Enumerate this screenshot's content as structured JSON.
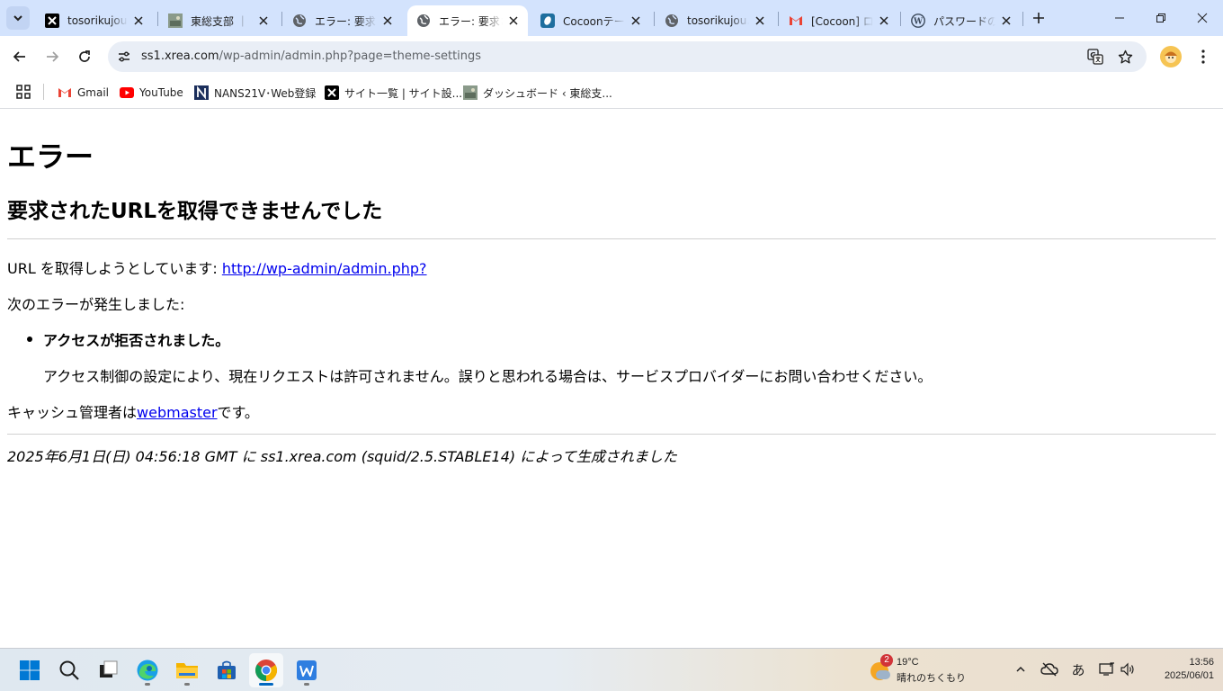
{
  "browser": {
    "tabs": [
      {
        "title": "tosorikujou.s",
        "favicon": "x-logo-icon"
      },
      {
        "title": "東総支部 ｜ 千",
        "favicon": "site-thumbnail-icon"
      },
      {
        "title": "エラー: 要求さ",
        "favicon": "globe-icon"
      },
      {
        "title": "エラー: 要求さ",
        "favicon": "globe-icon",
        "active": true
      },
      {
        "title": "Cocoonテーマ",
        "favicon": "cocoon-icon"
      },
      {
        "title": "tosorikujou.s",
        "favicon": "globe-icon"
      },
      {
        "title": "[Cocoon] ログ",
        "favicon": "gmail-icon"
      },
      {
        "title": "パスワードのリセ",
        "favicon": "wordpress-icon"
      }
    ],
    "address": {
      "host": "ss1.xrea.com",
      "path": "/wp-admin/admin.php?page=theme-settings"
    },
    "bookmarks": [
      {
        "label": "Gmail",
        "icon": "gmail-icon"
      },
      {
        "label": "YouTube",
        "icon": "youtube-icon"
      },
      {
        "label": "NANS21V･Web登録",
        "icon": "nans-icon"
      },
      {
        "label": "サイト一覧 | サイト設...",
        "icon": "x-logo-icon"
      },
      {
        "label": "ダッシュボード ‹ 東総支...",
        "icon": "site-thumbnail-icon"
      }
    ]
  },
  "page": {
    "heading": "エラー",
    "subheading": "要求されたURLを取得できませんでした",
    "url_prefix": "URL を取得しようとしています: ",
    "url_link": "http://wp-admin/admin.php?",
    "error_intro": "次のエラーが発生しました:",
    "error_title": "アクセスが拒否されました。",
    "error_detail": "アクセス制御の設定により、現在リクエストは許可されません。誤りと思われる場合は、サービスプロバイダーにお問い合わせください。",
    "admin_prefix": "キャッシュ管理者は",
    "admin_link": "webmaster",
    "admin_suffix": "です。",
    "footer": "2025年6月1日(日) 04:56:18 GMT に ss1.xrea.com (squid/2.5.STABLE14) によって生成されました"
  },
  "taskbar": {
    "weather": {
      "badge": "2",
      "temp": "19°C",
      "condition": "晴れのちくもり"
    },
    "ime": "あ",
    "clock": {
      "time": "13:56",
      "date": "2025/06/01"
    }
  },
  "colors": {
    "tabstrip": "#d3e3fd",
    "link": "#0000ee",
    "omnibox": "#e9eef6"
  }
}
